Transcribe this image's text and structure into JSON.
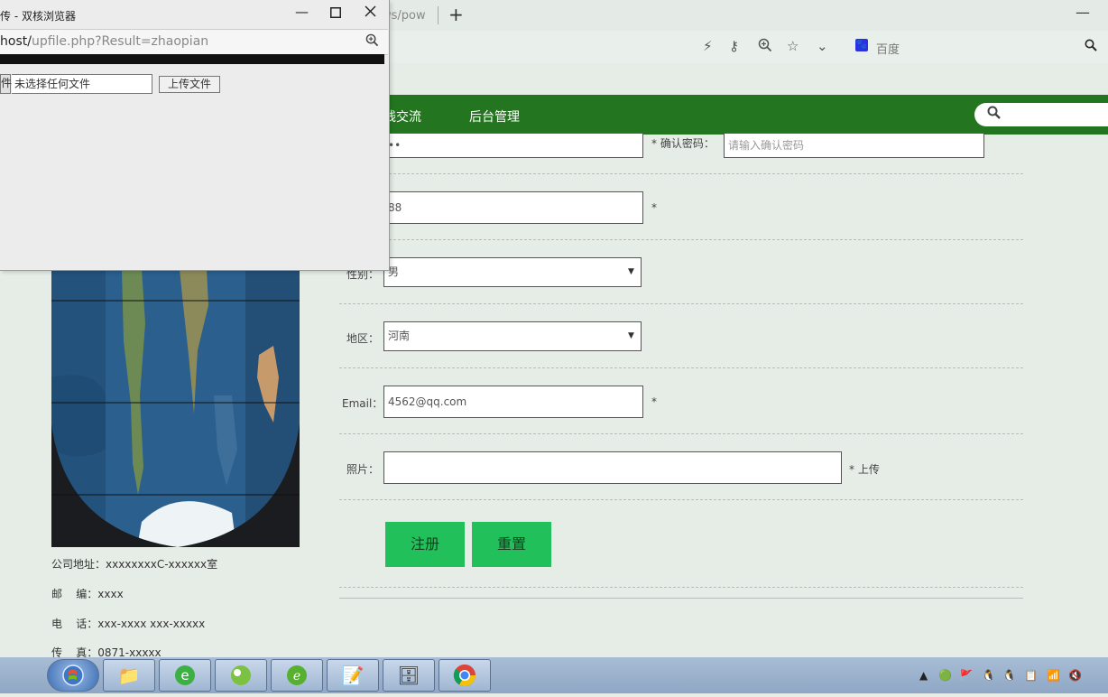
{
  "browser": {
    "tab_url_fragment": "ws/pow",
    "new_tab_label": "+",
    "minimize_label": "—",
    "toolbar_icons": [
      "lightning-icon",
      "key-icon",
      "zoom-icon",
      "star-icon",
      "chevron-down-icon"
    ],
    "search_engine": "百度"
  },
  "nav": {
    "items": [
      "线交流",
      "后台管理"
    ]
  },
  "form": {
    "password_value": "••",
    "confirm_label": "* 确认密码：",
    "confirm_placeholder": "请输入确认密码",
    "phone_value": "88",
    "star": "*",
    "gender_label": "性别：",
    "gender_value": "男",
    "region_label": "地区：",
    "region_value": "河南",
    "email_label": "Email：",
    "email_value": "4562@qq.com",
    "photo_label": "照片：",
    "photo_value": "",
    "upload_link": "* 上传",
    "submit_label": "注册",
    "reset_label": "重置"
  },
  "contact": {
    "address": "公司地址：xxxxxxxxC-xxxxxx室",
    "zip": "邮    编：xxxx",
    "phone": "电    话：xxx-xxxx xxx-xxxxx",
    "fax": "传    真：0871-xxxxx"
  },
  "popup": {
    "title": "传 - 双核浏览器",
    "url_host": "host/",
    "url_path": "upfile.php?Result=zhaopian",
    "file_btn_edge": "件",
    "file_name": "未选择任何文件",
    "upload_button": "上传文件"
  },
  "colors": {
    "nav_green": "#23761f",
    "button_green": "#22c05b",
    "page_bg": "#e6ede7"
  }
}
